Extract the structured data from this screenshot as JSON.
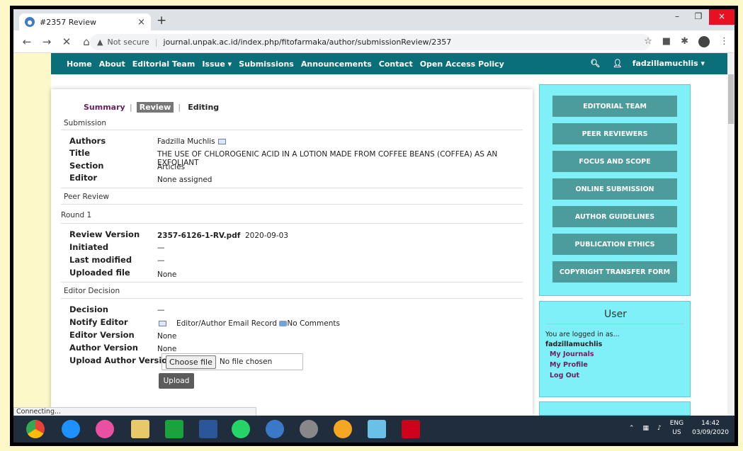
{
  "browser": {
    "tab_title": "#2357 Review",
    "tab_close": "×",
    "new_tab": "+",
    "window_min": "–",
    "window_max": "❐",
    "window_close": "×",
    "not_secure": "Not secure",
    "url": "journal.unpak.ac.id/index.php/fitofarmaka/author/submissionReview/2357",
    "status_text": "Connecting..."
  },
  "topnav": {
    "items": [
      "Home",
      "About",
      "Editorial Team",
      "Issue ▾",
      "Submissions",
      "Announcements",
      "Contact",
      "Open Access Policy"
    ],
    "user": "fadzillamuchlis ▾"
  },
  "tabs": {
    "summary": "Summary",
    "review": "Review",
    "editing": "Editing"
  },
  "submission": {
    "heading": "Submission",
    "authors_label": "Authors",
    "authors": "Fadzilla Muchlis",
    "title_label": "Title",
    "title": "THE USE OF CHLOROGENIC ACID IN A LOTION MADE FROM COFFEE BEANS (COFFEA) AS AN EXFOLIANT",
    "section_label": "Section",
    "section": "Articles",
    "editor_label": "Editor",
    "editor": "None assigned"
  },
  "peer_review": {
    "heading": "Peer Review",
    "round": "Round 1",
    "review_version_label": "Review Version",
    "review_version_file": "2357-6126-1-RV.pdf",
    "review_version_date": "2020-09-03",
    "initiated_label": "Initiated",
    "initiated": "—",
    "last_modified_label": "Last modified",
    "last_modified": "—",
    "uploaded_file_label": "Uploaded file",
    "uploaded_file": "None"
  },
  "editor_decision": {
    "heading": "Editor Decision",
    "decision_label": "Decision",
    "decision": "—",
    "notify_label": "Notify Editor",
    "notify_record": "Editor/Author Email Record",
    "no_comments": "No Comments",
    "editor_version_label": "Editor Version",
    "editor_version": "None",
    "author_version_label": "Author Version",
    "author_version": "None",
    "upload_label": "Upload Author Version",
    "choose_file": "Choose file",
    "no_file": "No file chosen",
    "upload_button": "Upload"
  },
  "sidebar": {
    "buttons": [
      "EDITORIAL TEAM",
      "PEER REVIEWERS",
      "FOCUS AND SCOPE",
      "ONLINE SUBMISSION",
      "AUTHOR GUIDELINES",
      "PUBLICATION ETHICS",
      "COPYRIGHT TRANSFER FORM"
    ],
    "user_heading": "User",
    "logged_in_as": "You are logged in as...",
    "username": "fadzillamuchlis",
    "links": [
      "My Journals",
      "My Profile",
      "Log Out"
    ]
  },
  "tray": {
    "lang1": "ENG",
    "lang2": "US",
    "time": "14:42",
    "date": "03/09/2020"
  },
  "colors": {
    "nav": "#0a6f79",
    "sidebar": "#80f0f8",
    "button": "#4d9c9c",
    "link": "#6a1f5e"
  }
}
